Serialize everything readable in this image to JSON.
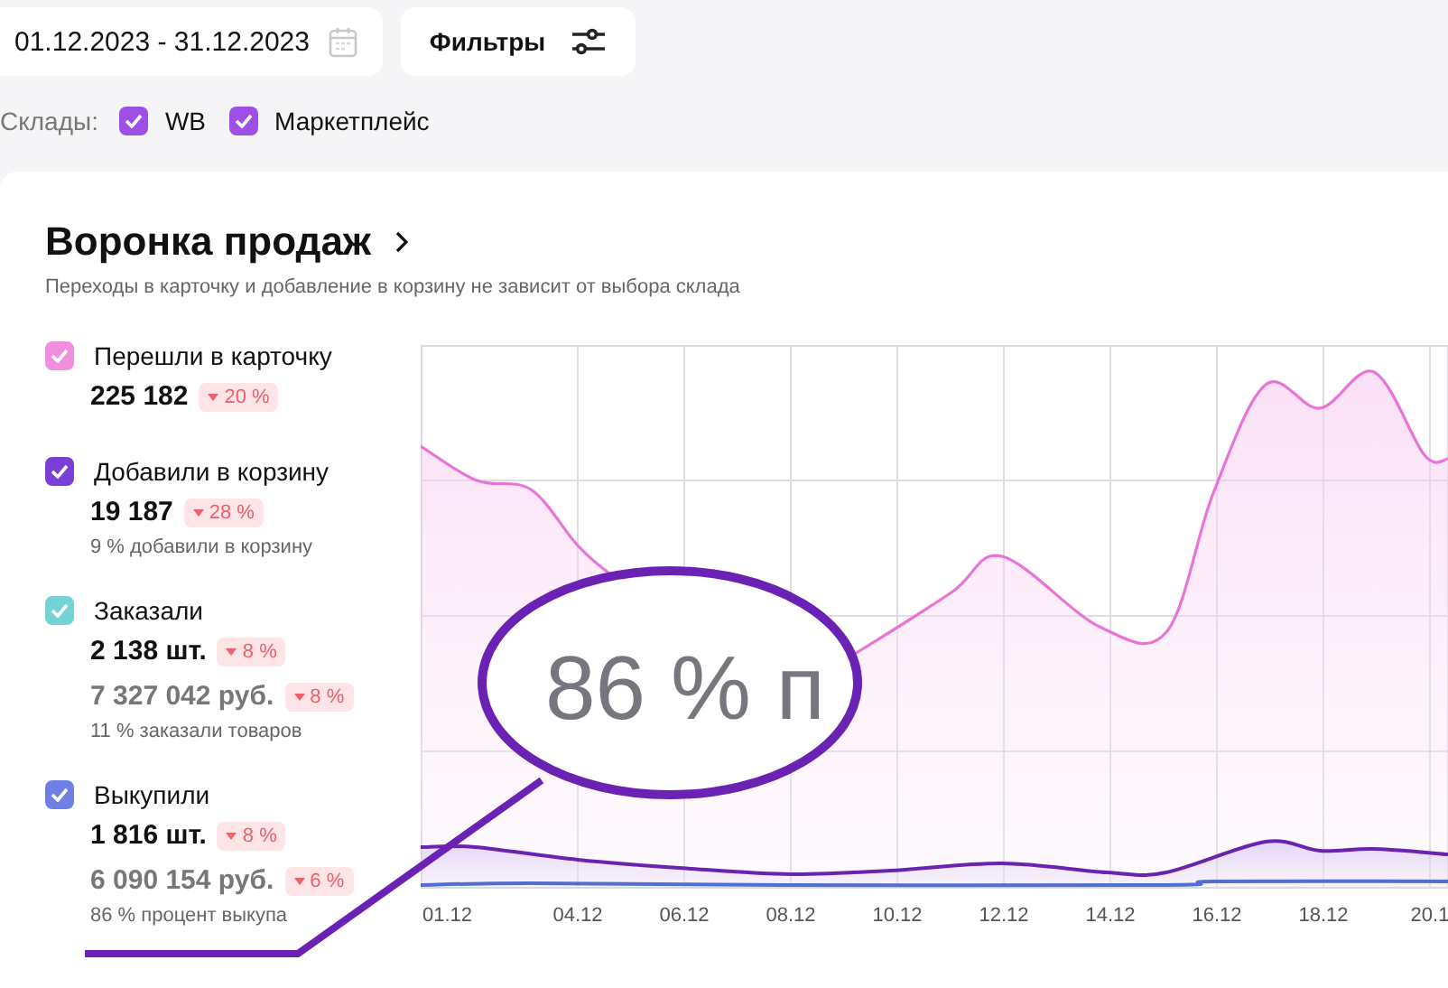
{
  "date_range": {
    "value": "01.12.2023 - 31.12.2023"
  },
  "filters_button": {
    "label": "Фильтры"
  },
  "warehouses": {
    "label": "Склады:",
    "options": [
      {
        "label": "WB",
        "checked": true
      },
      {
        "label": "Маркетплейс",
        "checked": true
      }
    ]
  },
  "funnel": {
    "title": "Воронка продаж",
    "subtitle": "Переходы в карточку и добавление в корзину не зависит от выбора склада",
    "metrics": [
      {
        "label": "Перешли в карточку",
        "color": "#f28ee0",
        "checked": true,
        "values": [
          {
            "kind": "count",
            "value": "225 182",
            "change": "20 %"
          }
        ]
      },
      {
        "label": "Добавили в корзину",
        "color": "#7b3fd6",
        "checked": true,
        "values": [
          {
            "kind": "count",
            "value": "19 187",
            "change": "28 %"
          }
        ],
        "note": "9 % добавили в корзину"
      },
      {
        "label": "Заказали",
        "color": "#72d4d4",
        "checked": true,
        "values": [
          {
            "kind": "count",
            "value": "2 138 шт.",
            "change": "8 %"
          },
          {
            "kind": "sum",
            "value": "7 327 042 руб.",
            "change": "8 %"
          }
        ],
        "note": "11 % заказали товаров"
      },
      {
        "label": "Выкупили",
        "color": "#6f7fe6",
        "checked": true,
        "values": [
          {
            "kind": "count",
            "value": "1 816 шт.",
            "change": "8 %"
          },
          {
            "kind": "sum",
            "value": "6 090 154 руб.",
            "change": "6 %"
          }
        ],
        "note": "86 % процент выкупа"
      }
    ],
    "chart": {
      "x_labels": [
        "01.12",
        "04.12",
        "06.12",
        "08.12",
        "10.12",
        "12.12",
        "14.12",
        "16.12",
        "18.12",
        "20.1"
      ]
    },
    "magnifier": {
      "text": "86 % п"
    }
  }
}
